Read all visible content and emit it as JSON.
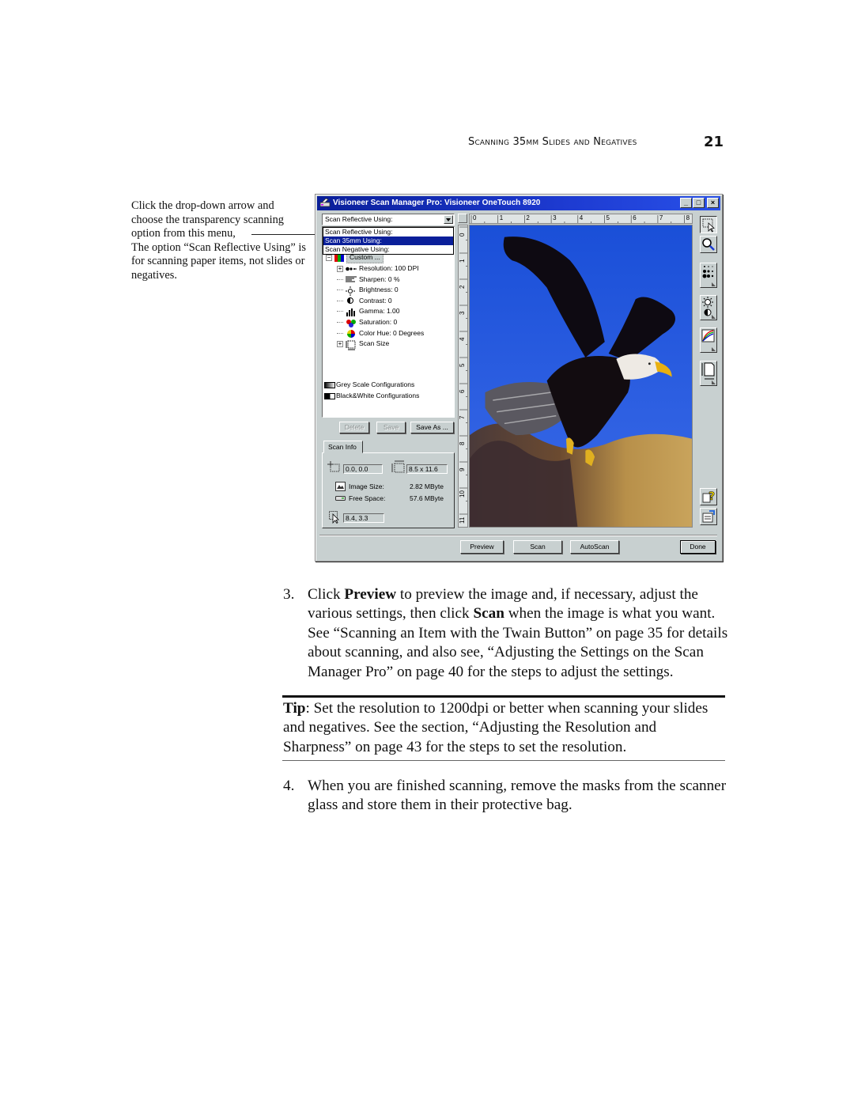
{
  "running_head": {
    "section": "Scanning 35mm Slides and Negatives",
    "page_number": "21"
  },
  "caption": {
    "line1": "Click the drop-down arrow and choose the transparency scanning option from this menu,",
    "line2": "The option “Scan Reflective Using” is for scanning paper items, not slides or negatives."
  },
  "window": {
    "title": "Visioneer Scan Manager Pro:  Visioneer OneTouch 8920",
    "buttons": {
      "minimize": "_",
      "maximize": "□",
      "close": "×"
    },
    "scan_mode": {
      "selected": "Scan Reflective Using:",
      "options": [
        {
          "label": "Scan Reflective Using:",
          "highlighted": false
        },
        {
          "label": "Scan 35mm Using:",
          "highlighted": true
        },
        {
          "label": "Scan Negative Using:",
          "highlighted": false
        }
      ]
    },
    "tree": {
      "custom": "Custom ...",
      "items": [
        {
          "label": "Resolution: 100 DPI",
          "icon": "resolution-icon",
          "expandable": true
        },
        {
          "label": "Sharpen: 0 %",
          "icon": "sharpen-icon",
          "expandable": false
        },
        {
          "label": "Brightness: 0",
          "icon": "brightness-icon",
          "expandable": false
        },
        {
          "label": "Contrast: 0",
          "icon": "contrast-icon",
          "expandable": false
        },
        {
          "label": "Gamma: 1.00",
          "icon": "gamma-icon",
          "expandable": false
        },
        {
          "label": "Saturation: 0",
          "icon": "saturation-icon",
          "expandable": false
        },
        {
          "label": "Color Hue: 0 Degrees",
          "icon": "color-hue-icon",
          "expandable": false
        },
        {
          "label": "Scan Size",
          "icon": "scan-size-icon",
          "expandable": true
        }
      ],
      "configs": [
        {
          "label": "Grey Scale Configurations",
          "icon": "greyscale-icon"
        },
        {
          "label": "Black&White Configurations",
          "icon": "black-white-icon"
        }
      ]
    },
    "config_buttons": {
      "delete": "Delete",
      "save": "Save",
      "save_as": "Save As ..."
    },
    "scan_info": {
      "tab": "Scan Info",
      "origin": "0.0, 0.0",
      "size": "8.5 x 11.6",
      "image_size_label": "Image Size:",
      "image_size_value": "2.82 MByte",
      "free_space_label": "Free Space:",
      "free_space_value": "57.6 MByte",
      "cursor": "8.4, 3.3"
    },
    "ruler": {
      "horizontal": [
        "0",
        "1",
        "2",
        "3",
        "4",
        "5",
        "6",
        "7",
        "8"
      ],
      "vertical": [
        "0",
        "1",
        "2",
        "3",
        "4",
        "5",
        "6",
        "7",
        "8",
        "9",
        "10",
        "11"
      ]
    },
    "toolbar": [
      {
        "name": "select-area-tool",
        "icon": "marquee-icon"
      },
      {
        "name": "zoom-tool",
        "icon": "magnifier-icon"
      },
      {
        "name": "halftone-tool",
        "icon": "halftone-icon"
      },
      {
        "name": "brightness-contrast-tool",
        "icon": "brightness-contrast-icon"
      },
      {
        "name": "color-curve-tool",
        "icon": "color-curve-icon"
      },
      {
        "name": "scan-size-tool",
        "icon": "page-size-icon"
      },
      {
        "name": "help-tool",
        "icon": "help-icon"
      },
      {
        "name": "settings-tool",
        "icon": "settings-icon"
      }
    ],
    "actions": {
      "preview": "Preview",
      "scan": "Scan",
      "autoscan": "AutoScan",
      "done": "Done"
    }
  },
  "steps": [
    {
      "number": "3.",
      "parts": [
        {
          "text": "Click ",
          "bold": false
        },
        {
          "text": "Preview",
          "bold": true
        },
        {
          "text": " to preview the image and, if necessary, adjust the various settings, then click ",
          "bold": false
        },
        {
          "text": "Scan",
          "bold": true
        },
        {
          "text": " when the image is what you want. See “Scanning an Item with the Twain Button” on page 35 for details about scanning, and also see, “Adjusting the Settings on the Scan Manager Pro” on page 40 for the steps to adjust the settings.",
          "bold": false
        }
      ]
    },
    {
      "number": "4.",
      "parts": [
        {
          "text": "When you are finished scanning, remove the masks from the scanner glass and store them in their protective bag.",
          "bold": false
        }
      ]
    }
  ],
  "tip": {
    "label": "Tip",
    "text": ":  Set the resolution to 1200dpi or better when scanning your slides and negatives. See the section, “Adjusting the Resolution and Sharpness” on page 43 for the steps to set the resolution."
  }
}
